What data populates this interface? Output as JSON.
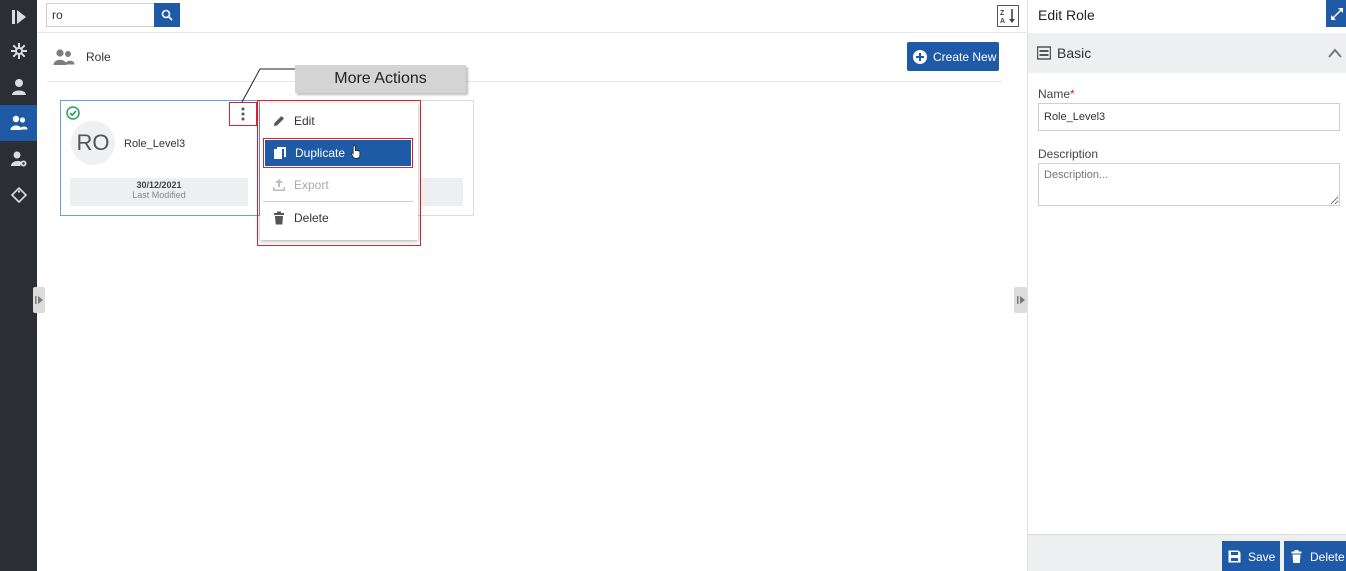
{
  "search": {
    "value": "ro",
    "placeholder": ""
  },
  "header": {
    "title": "Role",
    "create_label": "Create New"
  },
  "card": {
    "initials": "RO",
    "name": "Role_Level3",
    "date": "30/12/2021",
    "date_label": "Last Modified"
  },
  "callout": {
    "label": "More Actions"
  },
  "menu": {
    "items": [
      {
        "label": "Edit",
        "icon": "pencil-icon",
        "state": "normal"
      },
      {
        "label": "Duplicate",
        "icon": "copy-icon",
        "state": "highlighted"
      },
      {
        "label": "Export",
        "icon": "upload-icon",
        "state": "disabled"
      },
      {
        "label": "Delete",
        "icon": "trash-icon",
        "state": "normal"
      }
    ]
  },
  "panel": {
    "title": "Edit Role",
    "section": "Basic",
    "name_label": "Name",
    "required_mark": "*",
    "name_value": "Role_Level3",
    "description_label": "Description",
    "description_placeholder": "Description...",
    "save_label": "Save",
    "delete_label": "Delete"
  },
  "colors": {
    "accent": "#1f5aa6",
    "nav_bg": "#2b2e33",
    "highlight_border": "#d9232d",
    "success": "#2e9e5b"
  }
}
